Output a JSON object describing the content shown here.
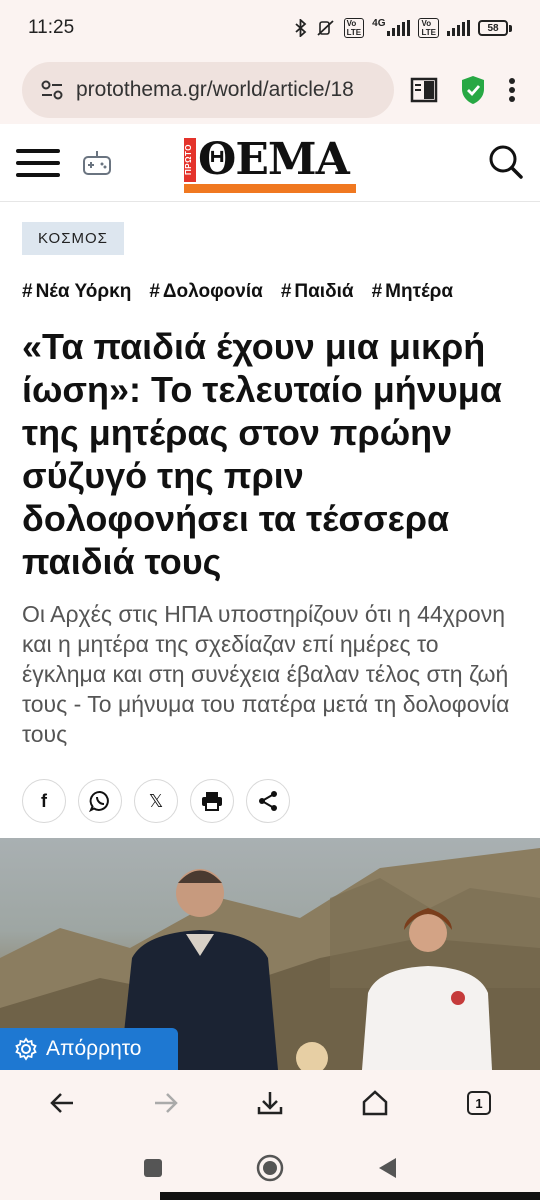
{
  "status_bar": {
    "time": "11:25",
    "network": "4G",
    "battery": "58"
  },
  "browser": {
    "url": "protothema.gr/world/article/18",
    "tab_count": "1"
  },
  "site": {
    "logo_top": "ΠΡΩΤΟ",
    "logo_word": "ΘΕΜΑ",
    "accent": "#f07820"
  },
  "article": {
    "category": "ΚΟΣΜΟΣ",
    "tags": [
      "Νέα Υόρκη",
      "Δολοφονία",
      "Παιδιά",
      "Μητέρα"
    ],
    "title": "«Τα παιδιά έχουν μια μικρή ίωση»: Το τελευταίο μήνυμα της μητέρας στον πρώην σύζυγό της πριν δολοφονήσει τα τέσσερα παιδιά τους",
    "lead": "Οι Αρχές στις ΗΠΑ υποστηρίζουν ότι η 44χρονη και η μητέρα της σχεδίαζαν επί ημέρες το έγκλημα και στη συνέχεια έβαλαν τέλος στη ζωή τους - Το μήνυμα του πατέρα μετά τη δολοφονία τους",
    "share": {
      "facebook": "f",
      "x": "𝕏"
    }
  },
  "privacy": {
    "label": "Απόρρητο"
  }
}
